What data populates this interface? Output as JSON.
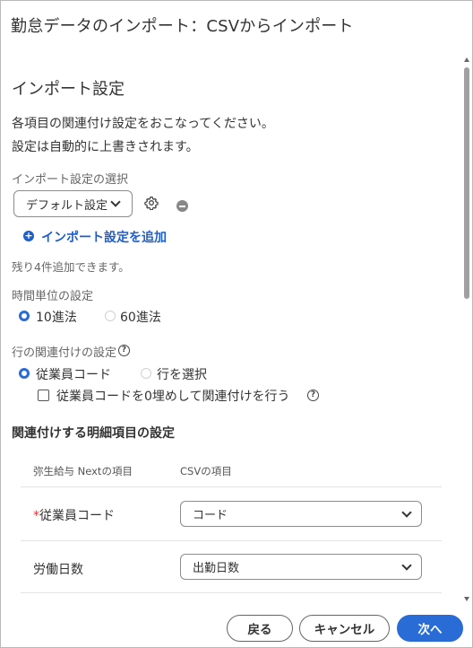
{
  "dialog": {
    "title": "勤怠データのインポート：CSVからインポート"
  },
  "settings": {
    "heading": "インポート設定",
    "description_line1": "各項目の関連付け設定をおこなってください。",
    "description_line2": "設定は自動的に上書きされます。",
    "select_label": "インポート設定の選択",
    "select_value": "デフォルト設定",
    "add_link": "インポート設定を追加",
    "remaining_note": "残り4件追加できます。"
  },
  "time_unit": {
    "label": "時間単位の設定",
    "options": [
      {
        "label": "10進法",
        "selected": true
      },
      {
        "label": "60進法",
        "selected": false
      }
    ]
  },
  "row_mapping": {
    "label": "行の関連付けの設定",
    "options": [
      {
        "label": "従業員コード",
        "selected": true
      },
      {
        "label": "行を選択",
        "selected": false
      }
    ],
    "checkbox_label": "従業員コードを0埋めして関連付けを行う",
    "checkbox_checked": false
  },
  "detail_mapping": {
    "heading": "関連付けする明細項目の設定",
    "col_source": "弥生給与 Nextの項目",
    "col_csv": "CSVの項目",
    "rows": [
      {
        "required_mark": "*",
        "label": "従業員コード",
        "value": "コード"
      },
      {
        "required_mark": "",
        "label": "労働日数",
        "value": "出勤日数"
      }
    ]
  },
  "footer": {
    "back_label": "戻る",
    "cancel_label": "キャンセル",
    "next_label": "次へ"
  },
  "colors": {
    "accent": "#2a6cd6",
    "link": "#1f5fc9",
    "required": "#d23c3c"
  }
}
